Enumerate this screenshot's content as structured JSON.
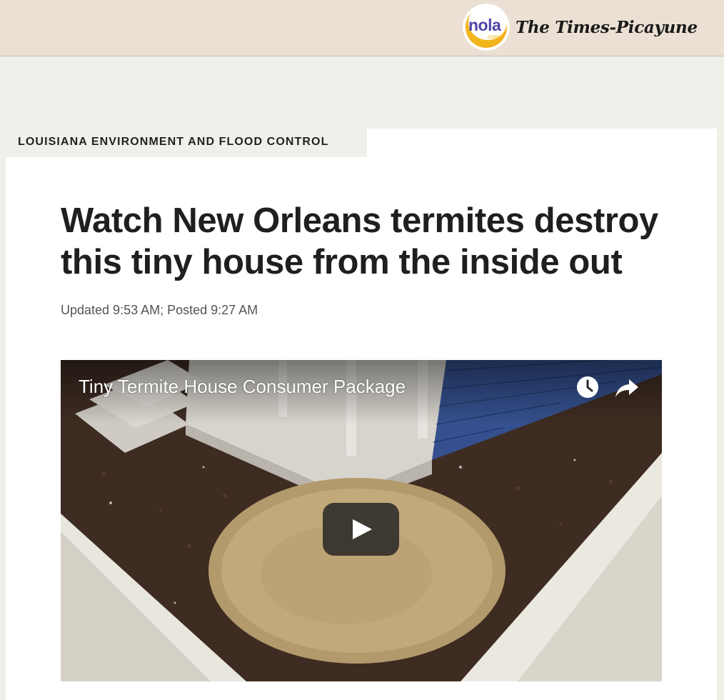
{
  "site": {
    "logo_text": "nola",
    "logo_sub": ".com",
    "masthead": "The Times-Picayune"
  },
  "article": {
    "section": "LOUISIANA ENVIRONMENT AND FLOOD CONTROL",
    "headline": "Watch New Orleans termites destroy this tiny house from the inside out",
    "timestamp": "Updated 9:53 AM; Posted 9:27 AM"
  },
  "video": {
    "title": "Tiny Termite House Consumer Package",
    "controls": {
      "watch_later_icon": "clock-icon",
      "share_icon": "share-arrow-icon",
      "play_icon": "play-icon"
    }
  },
  "colors": {
    "topbar_bg": "#ebe0d3",
    "page_bg": "#f0f0eb",
    "card_bg": "#ffffff",
    "nola_purple": "#4f45a8",
    "nola_gold": "#f2b51c",
    "headline_text": "#1f1f1f",
    "meta_text": "#555555"
  }
}
